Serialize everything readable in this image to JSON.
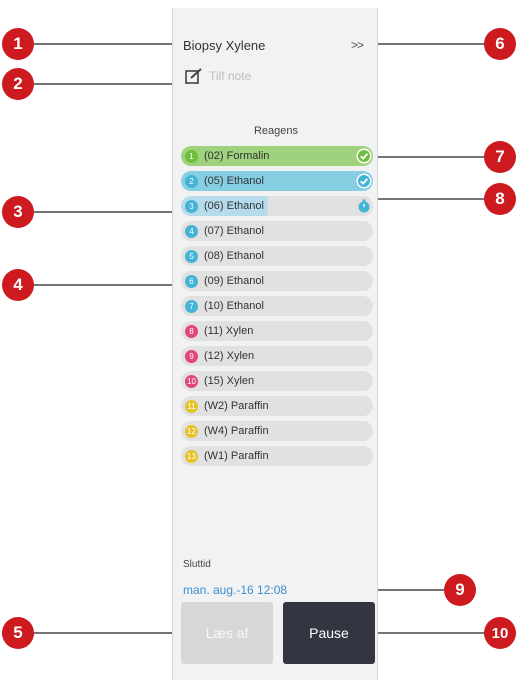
{
  "panel": {
    "title": "Biopsy Xylene",
    "expand_label": ">>",
    "note_placeholder": "Tilf note",
    "reagents_heading": "Reagens",
    "reagents": [
      {
        "num": "1",
        "label": "(02) Formalin",
        "num_color": "#6fbf3f",
        "row_color": "#9fd27c",
        "status": "done"
      },
      {
        "num": "2",
        "label": "(05) Ethanol",
        "num_color": "#43b4d6",
        "row_color": "#86cfe2",
        "status": "done"
      },
      {
        "num": "3",
        "label": "(06) Ethanol",
        "num_color": "#43b4d6",
        "row_color": "#e1e1e1",
        "status": "running",
        "progress": 0.45
      },
      {
        "num": "4",
        "label": "(07) Ethanol",
        "num_color": "#43b4d6",
        "row_color": "#e1e1e1",
        "status": ""
      },
      {
        "num": "5",
        "label": "(08) Ethanol",
        "num_color": "#43b4d6",
        "row_color": "#e1e1e1",
        "status": ""
      },
      {
        "num": "6",
        "label": "(09) Ethanol",
        "num_color": "#43b4d6",
        "row_color": "#e1e1e1",
        "status": ""
      },
      {
        "num": "7",
        "label": "(10) Ethanol",
        "num_color": "#43b4d6",
        "row_color": "#e1e1e1",
        "status": ""
      },
      {
        "num": "8",
        "label": "(11) Xylen",
        "num_color": "#e0457b",
        "row_color": "#e1e1e1",
        "status": ""
      },
      {
        "num": "9",
        "label": "(12) Xylen",
        "num_color": "#e0457b",
        "row_color": "#e1e1e1",
        "status": ""
      },
      {
        "num": "10",
        "label": "(15) Xylen",
        "num_color": "#e0457b",
        "row_color": "#e1e1e1",
        "status": ""
      },
      {
        "num": "11",
        "label": "(W2) Paraffin",
        "num_color": "#e6c229",
        "row_color": "#e1e1e1",
        "status": ""
      },
      {
        "num": "12",
        "label": "(W4) Paraffin",
        "num_color": "#e6c229",
        "row_color": "#e1e1e1",
        "status": ""
      },
      {
        "num": "13",
        "label": "(W1) Paraffin",
        "num_color": "#e6c229",
        "row_color": "#e1e1e1",
        "status": ""
      }
    ],
    "end_time_label": "Sluttid",
    "end_time_value": "man. aug.-16 12:08",
    "unload_button": "Læs af",
    "pause_button": "Pause"
  },
  "callouts": [
    "1",
    "2",
    "3",
    "4",
    "5",
    "6",
    "7",
    "8",
    "9",
    "10"
  ],
  "colors": {
    "callout": "#cc1a1f",
    "accent": "#3b8ed0"
  }
}
